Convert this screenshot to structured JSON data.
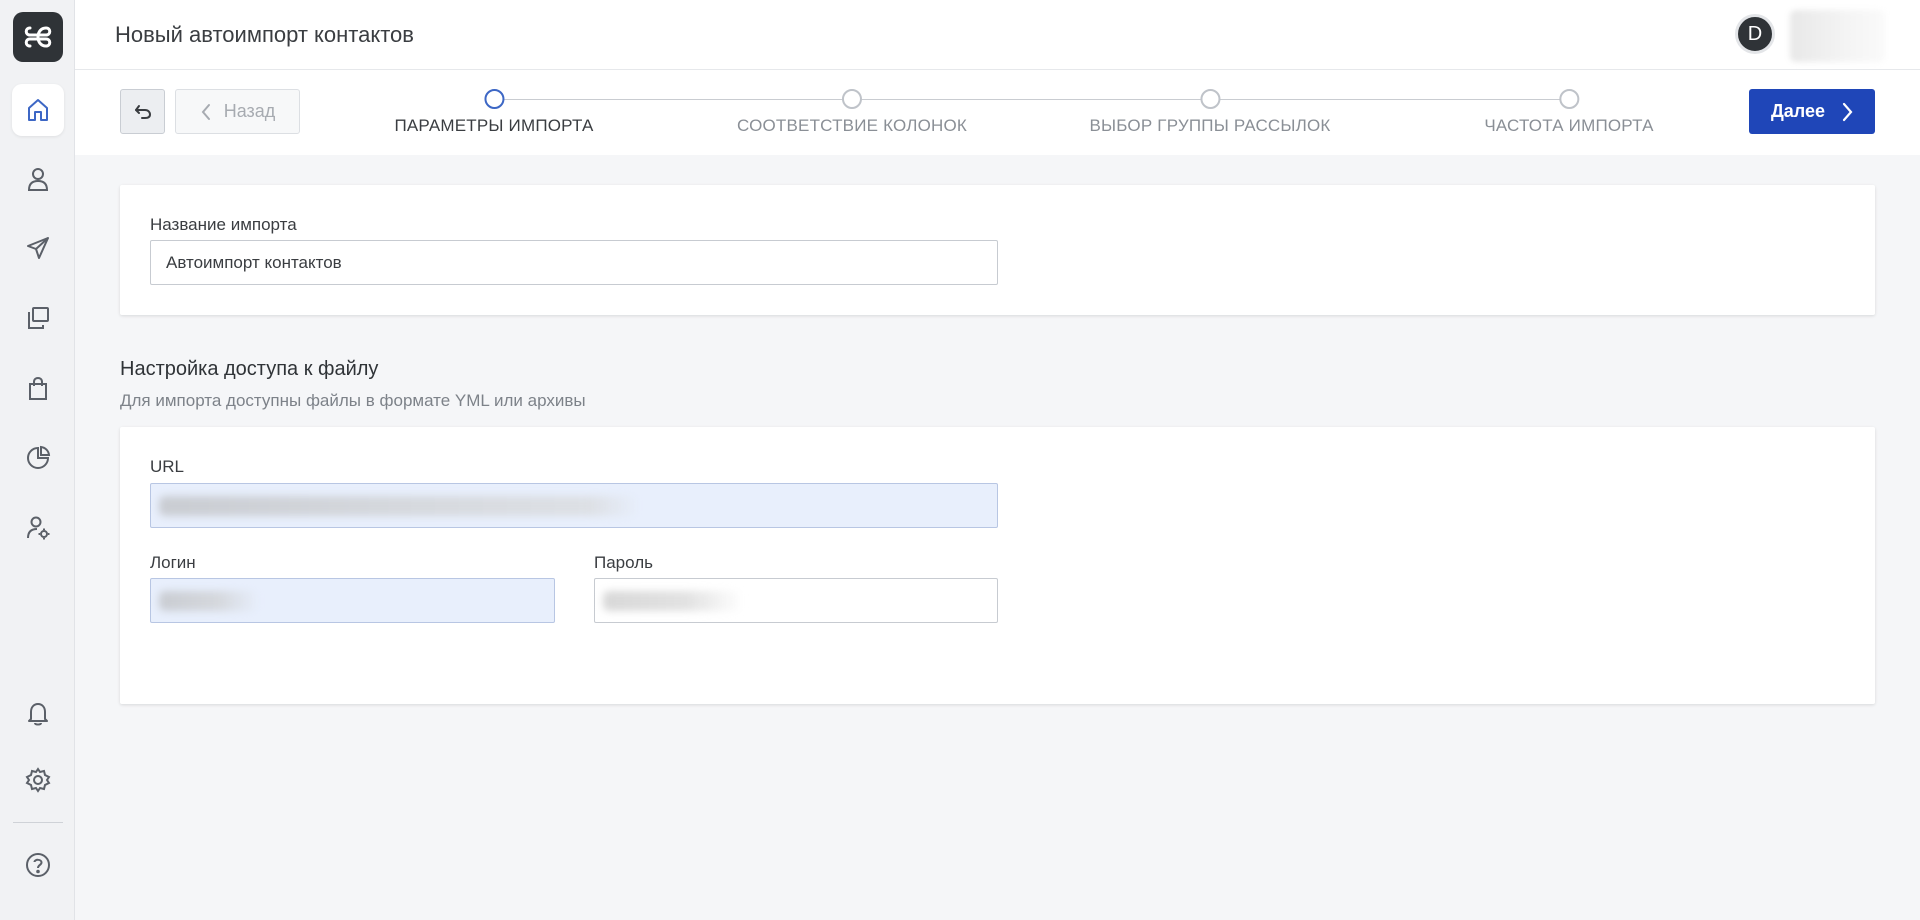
{
  "header": {
    "title": "Новый автоимпорт контактов",
    "avatar_letter": "D"
  },
  "wizard": {
    "back_label": "Назад",
    "next_label": "Далее",
    "steps": [
      {
        "label": "ПАРАМЕТРЫ ИМПОРТА",
        "active": true
      },
      {
        "label": "СООТВЕТСТВИЕ КОЛОНОК",
        "active": false
      },
      {
        "label": "ВЫБОР ГРУППЫ РАССЫЛОК",
        "active": false
      },
      {
        "label": "ЧАСТОТА ИМПОРТА",
        "active": false
      }
    ]
  },
  "import_name": {
    "label": "Название импорта",
    "value": "Автоимпорт контактов"
  },
  "file_access": {
    "title": "Настройка доступа к файлу",
    "description": "Для импорта доступны файлы в формате YML или архивы",
    "url_label": "URL",
    "login_label": "Логин",
    "password_label": "Пароль"
  },
  "sidebar": {
    "items": [
      "home-icon",
      "contacts-icon",
      "send-icon",
      "templates-icon",
      "shop-icon",
      "analytics-icon",
      "user-settings-icon",
      "notifications-icon",
      "settings-icon",
      "help-icon"
    ]
  },
  "colors": {
    "accent": "#1f46b8",
    "active_step": "#3d67c5",
    "autofill_bg": "#e8effc"
  }
}
